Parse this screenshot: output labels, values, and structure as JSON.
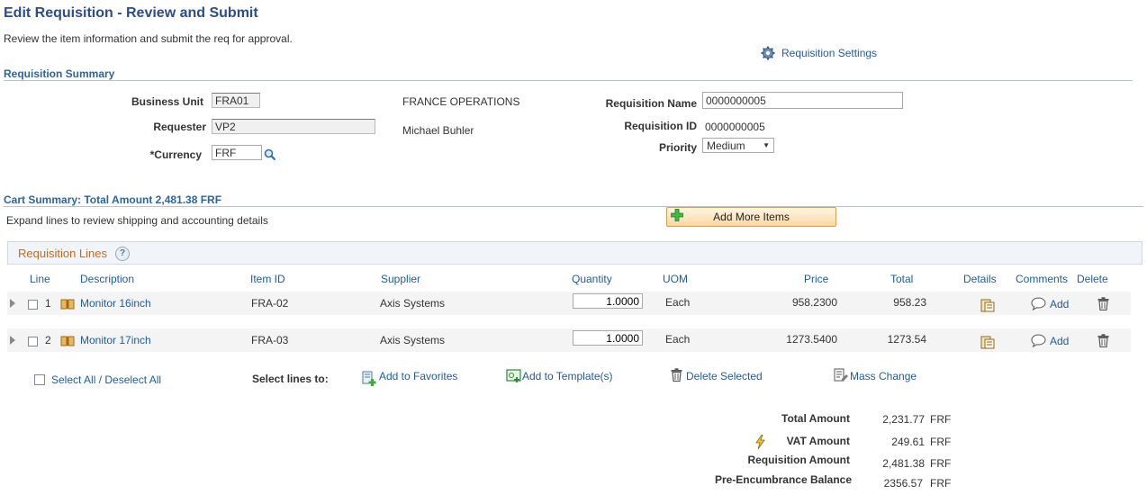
{
  "page": {
    "title": "Edit Requisition  - Review and Submit",
    "subtitle": "Review the item information and submit the req for approval.",
    "settings_link": "Requisition Settings"
  },
  "summary": {
    "section_title": "Requisition Summary",
    "business_unit_label": "Business Unit",
    "business_unit": "FRA01",
    "business_unit_desc": "FRANCE OPERATIONS",
    "requester_label": "Requester",
    "requester": "VP2",
    "requester_name": "Michael Buhler",
    "currency_label": "*Currency",
    "currency": "FRF",
    "req_name_label": "Requisition Name",
    "req_name": "0000000005",
    "req_id_label": "Requisition ID",
    "req_id": "0000000005",
    "priority_label": "Priority",
    "priority": "Medium"
  },
  "cart": {
    "section_title": "Cart Summary: Total Amount 2,481.38 FRF",
    "expand_text": "Expand lines to review shipping and accounting details",
    "add_more_label": "Add More Items",
    "grid_title": "Requisition Lines",
    "columns": {
      "line": "Line",
      "description": "Description",
      "item_id": "Item ID",
      "supplier": "Supplier",
      "quantity": "Quantity",
      "uom": "UOM",
      "price": "Price",
      "total": "Total",
      "details": "Details",
      "comments": "Comments",
      "delete": "Delete"
    },
    "rows": [
      {
        "line": "1",
        "description": "Monitor 16inch",
        "item_id": "FRA-02",
        "supplier": "Axis Systems",
        "quantity": "1.0000",
        "uom": "Each",
        "price": "958.2300",
        "total": "958.23",
        "comment": "Add"
      },
      {
        "line": "2",
        "description": "Monitor 17inch",
        "item_id": "FRA-03",
        "supplier": "Axis Systems",
        "quantity": "1.0000",
        "uom": "Each",
        "price": "1273.5400",
        "total": "1273.54",
        "comment": "Add"
      }
    ],
    "select_all": "Select All / Deselect All",
    "select_lines_to": "Select lines to:",
    "add_favorites": "Add to Favorites",
    "add_template": "Add to Template(s)",
    "delete_selected": "Delete Selected",
    "mass_change": "Mass Change"
  },
  "totals": {
    "total_amount_label": "Total Amount",
    "total_amount": "2,231.77",
    "vat_amount_label": "VAT Amount",
    "vat_amount": "249.61",
    "req_amount_label": "Requisition Amount",
    "req_amount": "2,481.38",
    "pre_enc_label": "Pre-Encumbrance Balance",
    "pre_enc": "2356.57",
    "currency": "FRF"
  }
}
